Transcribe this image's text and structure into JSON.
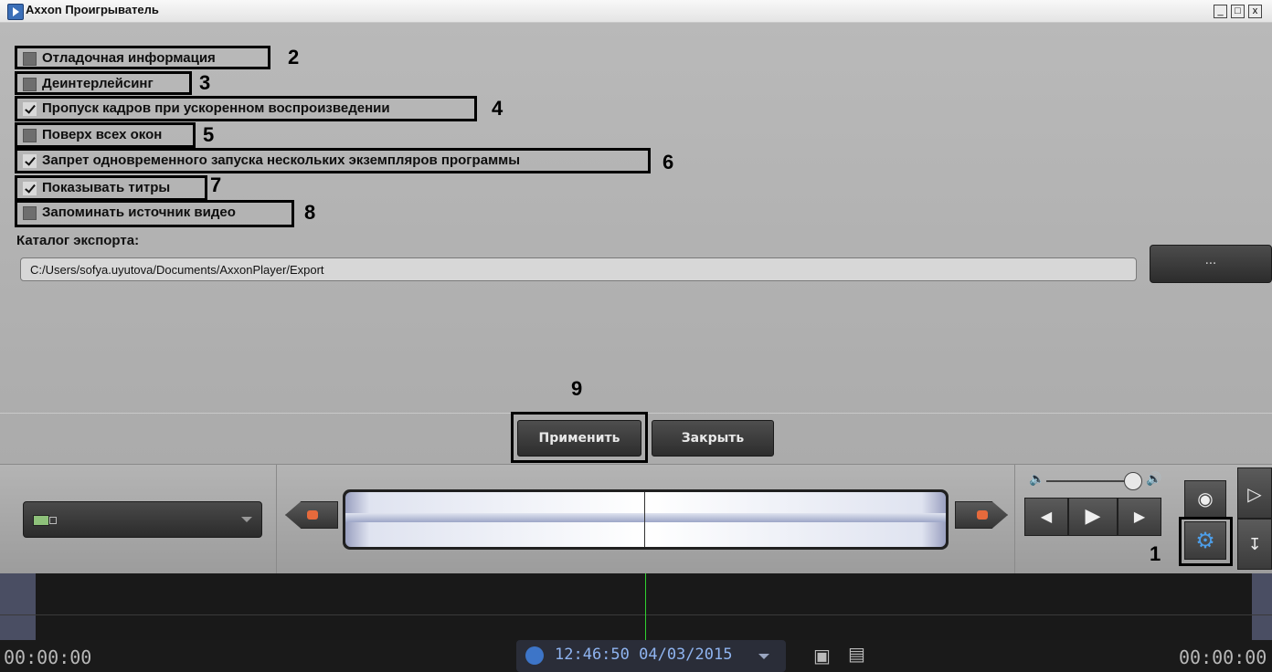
{
  "window": {
    "title": "Axxon Проигрыватель",
    "min_label": "_",
    "max_label": "□",
    "close_label": "x"
  },
  "settings": {
    "options": [
      {
        "label": "Отладочная информация",
        "checked": false,
        "num": "2"
      },
      {
        "label": "Деинтерлейсинг",
        "checked": false,
        "num": "3"
      },
      {
        "label": "Пропуск кадров при ускоренном воспроизведении",
        "checked": true,
        "num": "4"
      },
      {
        "label": "Поверх всех окон",
        "checked": false,
        "num": "5"
      },
      {
        "label": "Запрет одновременного запуска нескольких экземпляров программы",
        "checked": true,
        "num": "6"
      },
      {
        "label": "Показывать титры",
        "checked": true,
        "num": "7"
      },
      {
        "label": "Запоминать источник видео",
        "checked": false,
        "num": "8"
      }
    ],
    "export_label": "Каталог экспорта:",
    "export_path": "C:/Users/sofya.uyutova/Documents/AxxonPlayer/Export",
    "browse_label": "...",
    "apply_num": "9",
    "apply_label": "Применить",
    "close_label": "Закрыть"
  },
  "controls": {
    "settings_num": "1"
  },
  "timeline": {
    "left_time": "00:00:00",
    "right_time": "00:00:00",
    "clock": "12:46:50 04/03/2015"
  },
  "colors": {
    "panel": "#b7b7b7",
    "button_dark": "#333333",
    "accent_blue": "#3d75c8",
    "needle_green": "#2fd02f"
  }
}
